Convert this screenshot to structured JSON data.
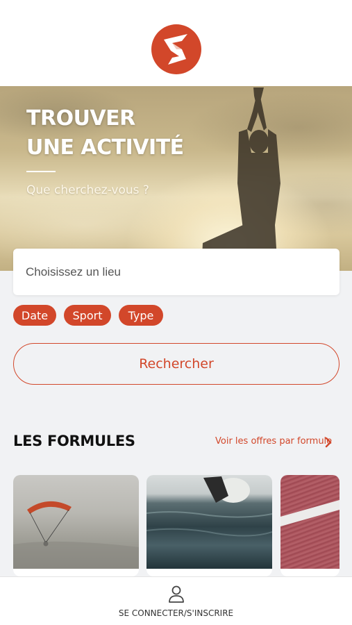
{
  "brand": {
    "accent": "#d2472a",
    "logo_icon": "brand-s-logo-icon"
  },
  "hero": {
    "title_line1": "TROUVER",
    "title_line2": "UNE ACTIVITÉ",
    "subtitle": "Que cherchez-vous ?"
  },
  "search": {
    "placeholder": "Choisissez un lieu",
    "value": ""
  },
  "filters": [
    {
      "label": "Date"
    },
    {
      "label": "Sport"
    },
    {
      "label": "Type"
    }
  ],
  "search_button": {
    "label": "Rechercher"
  },
  "formules": {
    "title": "LES FORMULES",
    "see_all_label": "Voir les offres par formule",
    "see_all_icon": "chevron-right-icon"
  },
  "bottom_nav": {
    "login_label": "SE CONNECTER/S'INSCRIRE",
    "login_icon": "user-icon"
  }
}
